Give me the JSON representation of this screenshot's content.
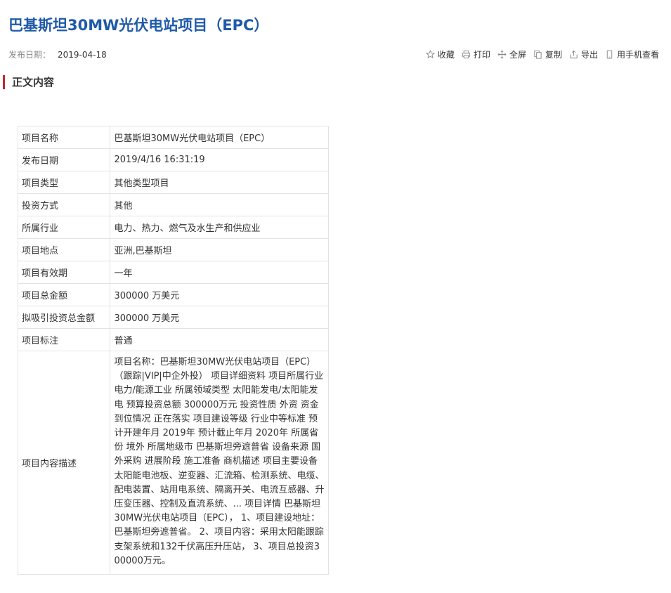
{
  "page": {
    "title": "巴基斯坦30MW光伏电站项目（EPC）",
    "publish_label": "发布日期：",
    "publish_date": "2019-04-18"
  },
  "toolbar": {
    "favorite": "收藏",
    "print": "打印",
    "fullscreen": "全屏",
    "copy": "复制",
    "export": "导出",
    "mobile": "用手机查看"
  },
  "section": {
    "title": "正文内容"
  },
  "details": [
    {
      "key": "项目名称",
      "value": "巴基斯坦30MW光伏电站项目（EPC）"
    },
    {
      "key": "发布日期",
      "value": "2019/4/16 16:31:19"
    },
    {
      "key": "项目类型",
      "value": "其他类型项目"
    },
    {
      "key": "投资方式",
      "value": "其他"
    },
    {
      "key": "所属行业",
      "value": " 电力、热力、燃气及水生产和供应业"
    },
    {
      "key": "项目地点",
      "value": "亚洲,巴基斯坦"
    },
    {
      "key": "项目有效期",
      "value": "一年"
    },
    {
      "key": "项目总金额",
      "value": "300000 万美元"
    },
    {
      "key": "拟吸引投资总金额",
      "value": "300000 万美元"
    },
    {
      "key": "项目标注",
      "value": "普通"
    },
    {
      "key": "项目内容描述",
      "value": "项目名称：巴基斯坦30MW光伏电站项目（EPC）（跟踪|VIP|中企外投） 项目详细资料 项目所属行业 电力/能源工业 所属领域类型 太阳能发电/太阳能发电 预算投资总额 300000万元 投资性质 外资 资金到位情况 正在落实 项目建设等级 行业中等标准 预计开建年月 2019年 预计截止年月 2020年 所属省份 境外 所属地级市 巴基斯坦旁遮普省 设备来源 国外采购 进展阶段 施工准备 商机描述 项目主要设备 太阳能电池板、逆变器、汇流箱、检测系统、电缆、配电装置、站用电系统、隔离开关、电流互感器、升压变压器、控制及直流系统、... 项目详情 巴基斯坦30MW光伏电站项目（EPC）， 1、项目建设地址：巴基斯坦旁遮普省。 2、项目内容：采用太阳能跟踪支架系统和132千伏高压升压站， 3、项目总投资300000万元。"
    }
  ]
}
